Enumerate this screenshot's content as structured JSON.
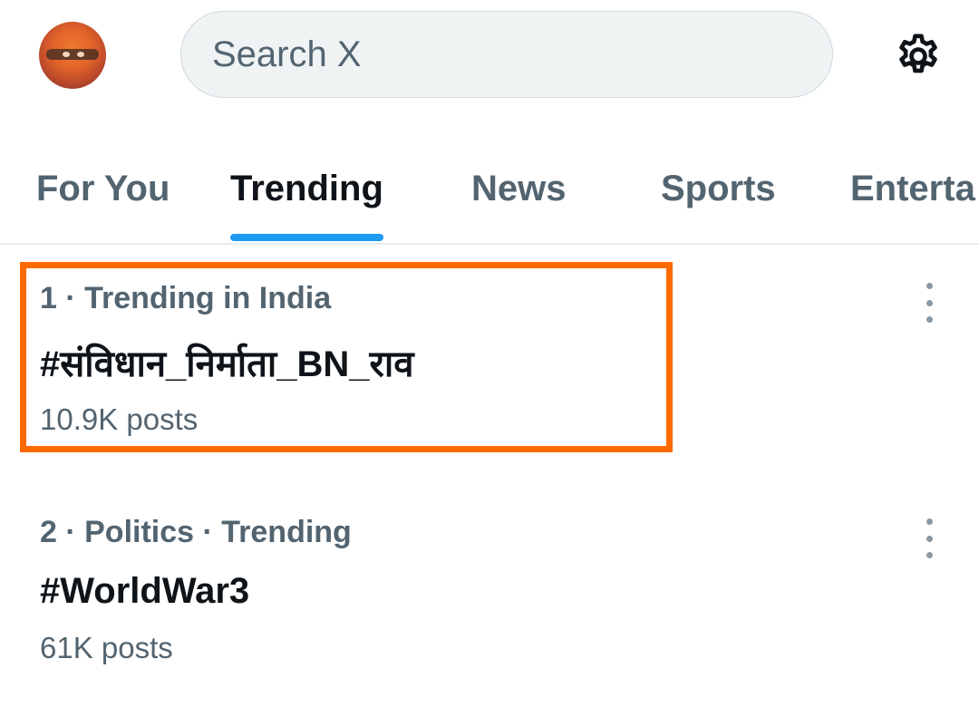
{
  "header": {
    "search_placeholder": "Search X",
    "avatar_icon": "user-avatar",
    "settings_icon": "gear-icon"
  },
  "tabs": [
    {
      "label": "For You",
      "active": false
    },
    {
      "label": "Trending",
      "active": true
    },
    {
      "label": "News",
      "active": false
    },
    {
      "label": "Sports",
      "active": false
    },
    {
      "label": "Enterta",
      "active": false
    }
  ],
  "trends": [
    {
      "context": "1 · Trending in India",
      "topic": "#संविधान_निर्माता_BN_राव",
      "posts": "10.9K posts",
      "highlighted": true
    },
    {
      "context": "2 · Politics · Trending",
      "topic": "#WorldWar3",
      "posts": "61K posts",
      "highlighted": false
    }
  ],
  "colors": {
    "accent": "#1d9bf0",
    "highlight_border": "#ff6a00",
    "secondary_text": "#536471",
    "primary_text": "#0f1419"
  }
}
